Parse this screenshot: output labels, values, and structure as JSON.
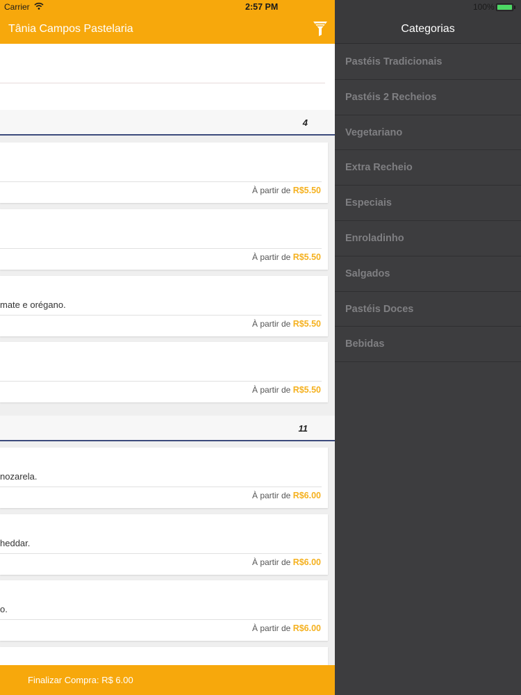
{
  "status_bar": {
    "carrier": "Carrier",
    "time": "2:57 PM",
    "battery": "100%"
  },
  "header": {
    "title": "Tânia Campos Pastelaria",
    "filter_icon": "filter-funnel-icon"
  },
  "sections": [
    {
      "count": "4"
    },
    {
      "count": "11"
    }
  ],
  "products": [
    {
      "description": "",
      "price_prefix": "À partir de",
      "price": "R$5.50"
    },
    {
      "description": "",
      "price_prefix": "À partir de",
      "price": "R$5.50"
    },
    {
      "description": "mate e orégano.",
      "price_prefix": "À partir de",
      "price": "R$5.50"
    },
    {
      "description": "",
      "price_prefix": "À partir de",
      "price": "R$5.50"
    },
    {
      "description": "nozarela.",
      "price_prefix": "À partir de",
      "price": "R$6.00"
    },
    {
      "description": "heddar.",
      "price_prefix": "À partir de",
      "price": "R$6.00"
    },
    {
      "description": "o.",
      "price_prefix": "À partir de",
      "price": "R$6.00"
    }
  ],
  "checkout": {
    "label": "Finalizar Compra: R$ 6.00"
  },
  "menu": {
    "title": "Categorias",
    "items": [
      {
        "label": "Pastéis Tradicionais"
      },
      {
        "label": "Pastéis 2 Recheios"
      },
      {
        "label": "Vegetariano"
      },
      {
        "label": "Extra Recheio"
      },
      {
        "label": "Especiais"
      },
      {
        "label": "Enroladinho"
      },
      {
        "label": "Salgados"
      },
      {
        "label": "Pastéis Doces"
      },
      {
        "label": "Bebidas"
      }
    ]
  },
  "colors": {
    "accent": "#f7a80c",
    "menu_bg": "#3d3d3f",
    "price": "#f5b11f",
    "section_rule": "#3c4a7c"
  }
}
